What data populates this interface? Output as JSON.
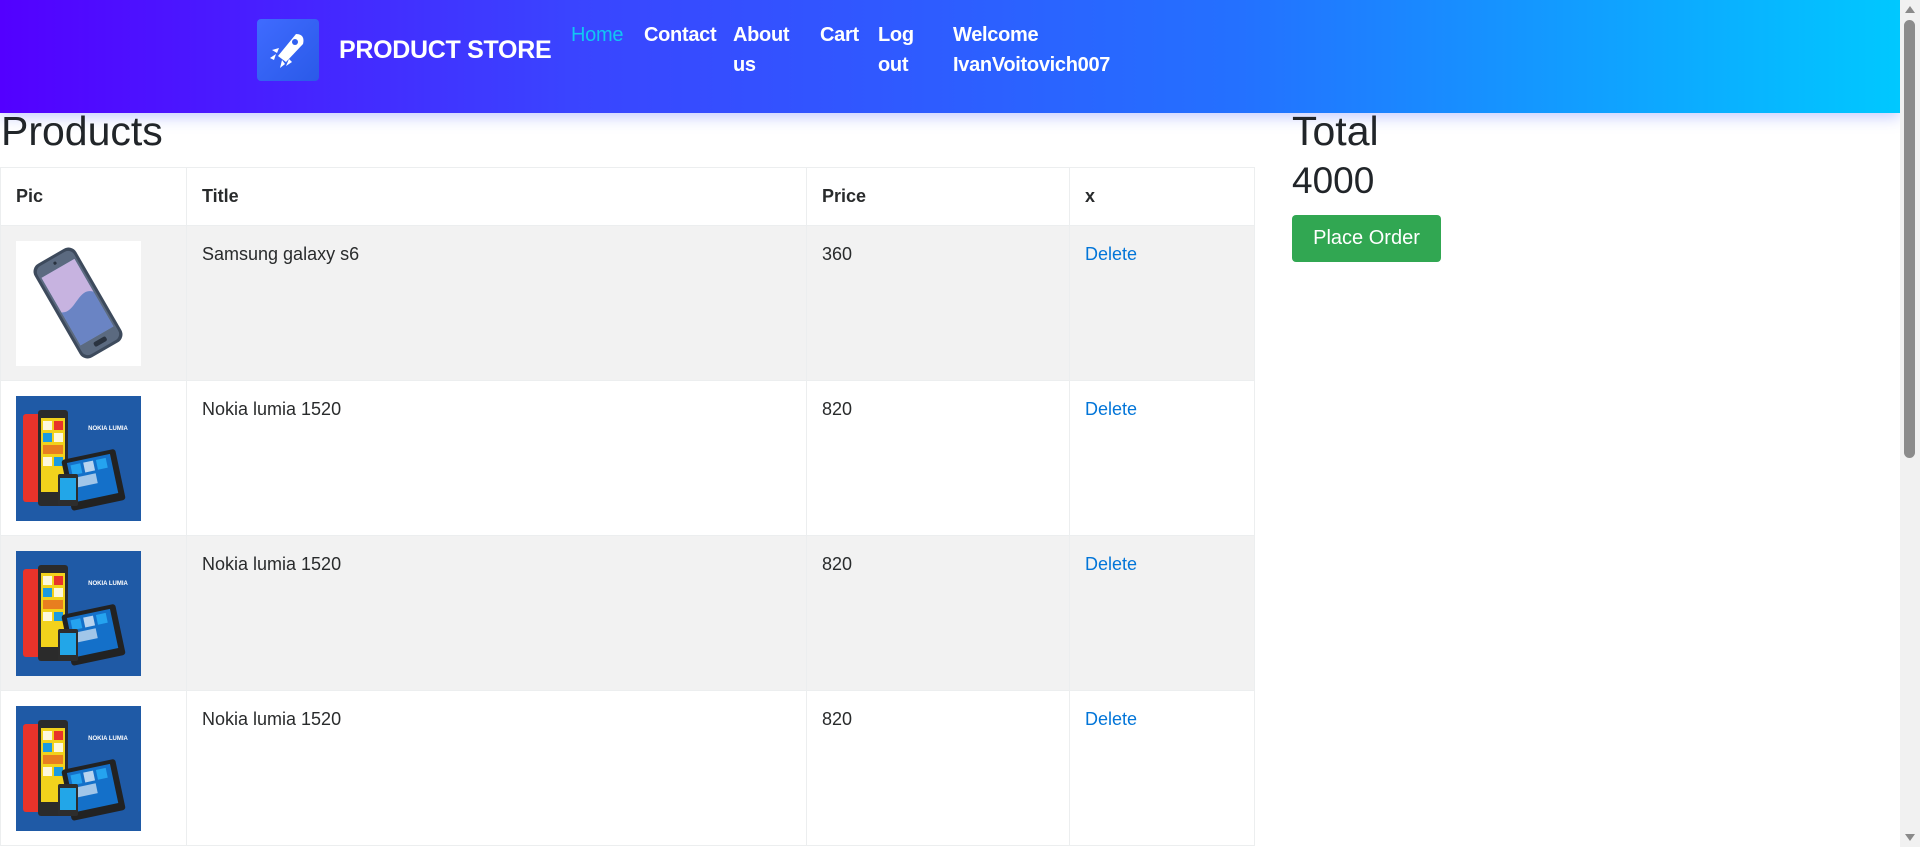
{
  "nav": {
    "brand": "PRODUCT STORE",
    "links": {
      "home": "Home",
      "contact": "Contact",
      "about_line1": "About",
      "about_line2": "us",
      "cart": "Cart",
      "logout_line1": "Log",
      "logout_line2": "out",
      "welcome_line1": "Welcome",
      "welcome_line2": "IvanVoitovich007"
    },
    "active": "home"
  },
  "products": {
    "heading": "Products",
    "columns": [
      "Pic",
      "Title",
      "Price",
      "x"
    ],
    "rows": [
      {
        "image": "samsung-galaxy-s6-image",
        "title": "Samsung galaxy s6",
        "price": "360",
        "action": "Delete"
      },
      {
        "image": "nokia-lumia-1520-image",
        "title": "Nokia lumia 1520",
        "price": "820",
        "action": "Delete"
      },
      {
        "image": "nokia-lumia-1520-image",
        "title": "Nokia lumia 1520",
        "price": "820",
        "action": "Delete"
      },
      {
        "image": "nokia-lumia-1520-image",
        "title": "Nokia lumia 1520",
        "price": "820",
        "action": "Delete"
      }
    ]
  },
  "summary": {
    "heading": "Total",
    "value": "4000",
    "button": "Place Order"
  },
  "colors": {
    "active_link": "#11c7f2",
    "delete_link": "#0275d8",
    "order_button": "#31a752"
  }
}
